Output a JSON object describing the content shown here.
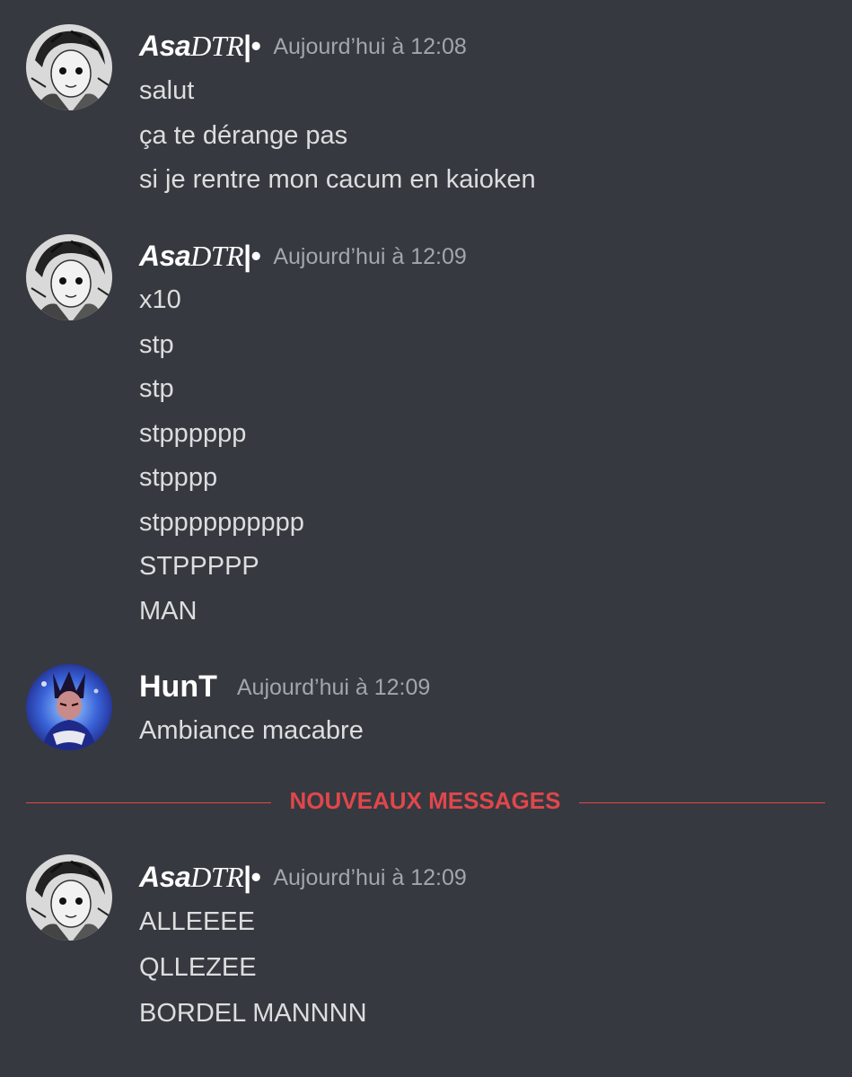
{
  "messages": [
    {
      "author": {
        "name_bold": "Asa",
        "name_serif": "DTR",
        "name_tail": "|•"
      },
      "timestamp": "Aujourd’hui à 12:08",
      "lines": [
        "salut",
        "ça te dérange pas",
        "si je rentre mon cacum en kaioken"
      ]
    },
    {
      "author": {
        "name_bold": "Asa",
        "name_serif": "DTR",
        "name_tail": "|•"
      },
      "timestamp": "Aujourd’hui à 12:09",
      "lines": [
        "x10",
        "stp",
        "stp",
        "stpppppp",
        "stpppp",
        "stpppppppppp",
        "STPPPPP",
        "MAN"
      ]
    },
    {
      "author": {
        "name": "HunT"
      },
      "timestamp": "Aujourd’hui à 12:09",
      "lines": [
        "Ambiance macabre"
      ]
    },
    {
      "author": {
        "name_bold": "Asa",
        "name_serif": "DTR",
        "name_tail": "|•"
      },
      "timestamp": "Aujourd’hui à 12:09",
      "lines": [
        "ALLEEEE",
        "QLLEZEE",
        "BORDEL MANNNN"
      ]
    }
  ],
  "new_messages_divider": {
    "label": "NOUVEAUX MESSAGES"
  },
  "colors": {
    "background": "#36393f",
    "text": "#dcddde",
    "username": "#ffffff",
    "timestamp": "#a3a6aa",
    "new_messages": "#e0474b"
  }
}
